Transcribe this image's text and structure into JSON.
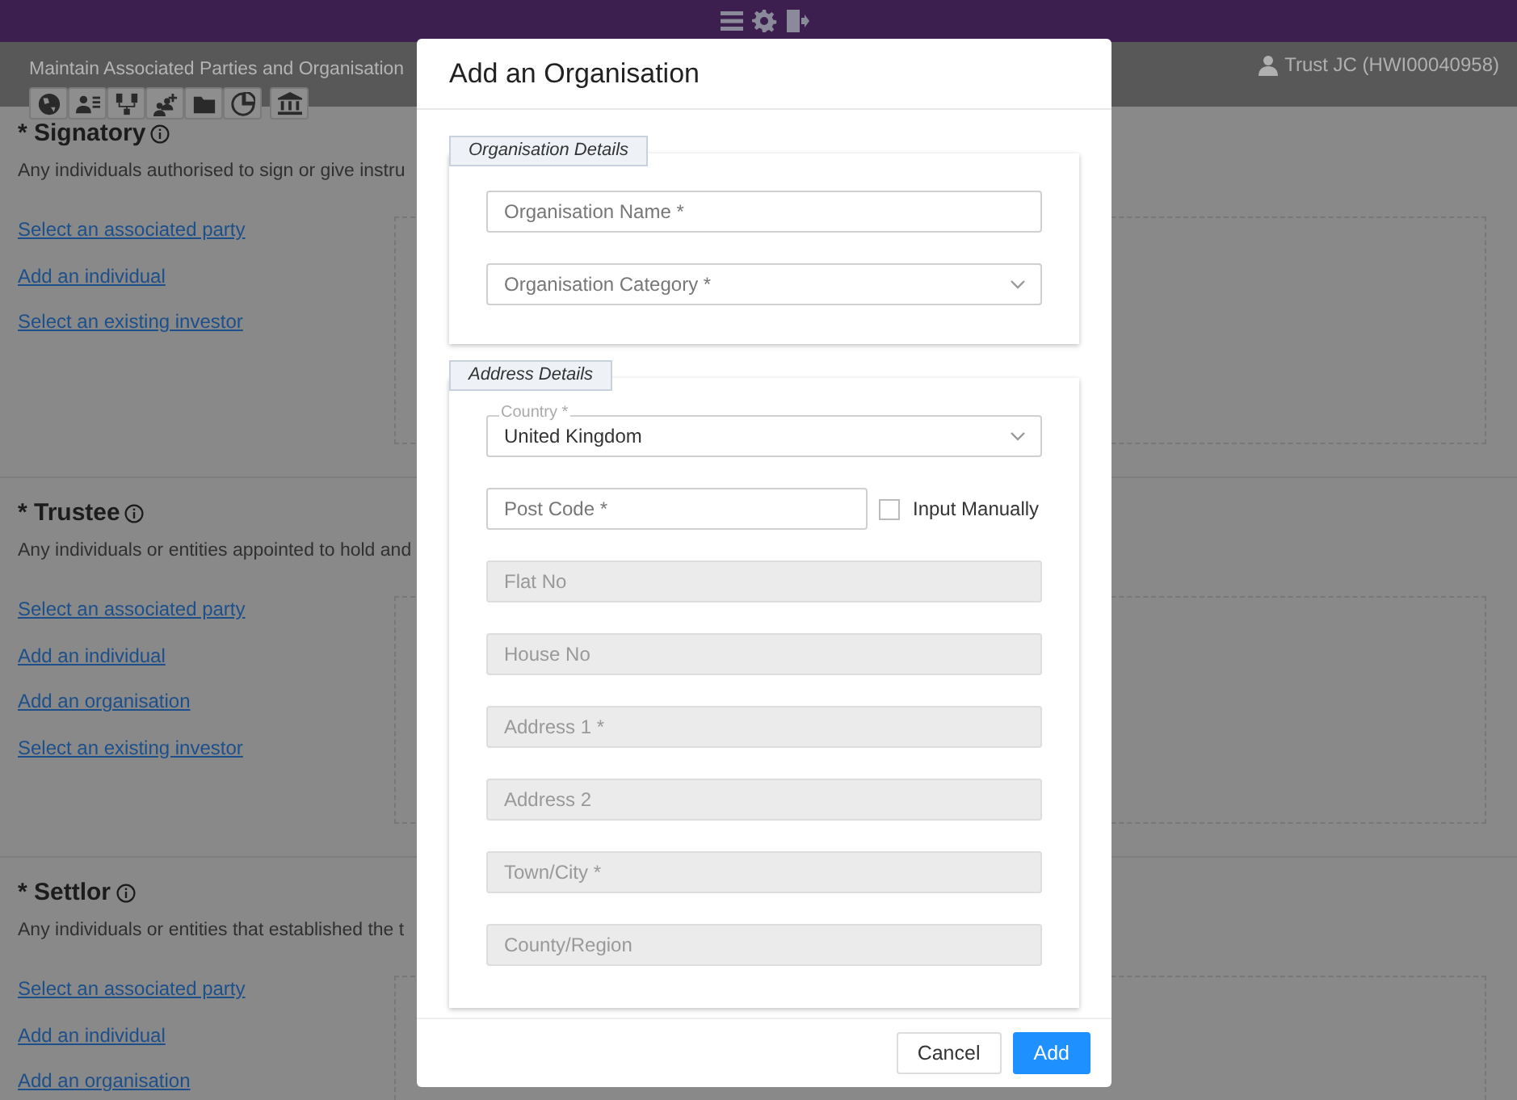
{
  "header": {
    "page_title": "Maintain Associated Parties and Organisation",
    "user": "Trust JC (HWI00040958)"
  },
  "sections": [
    {
      "title": "* Signatory",
      "description": "Any individuals authorised to sign or give instru",
      "links": [
        "Select an associated party",
        "Add an individual",
        "Select an existing investor"
      ]
    },
    {
      "title": "* Trustee",
      "description": "Any individuals or entities appointed to hold and",
      "links": [
        "Select an associated party",
        "Add an individual",
        "Add an organisation",
        "Select an existing investor"
      ]
    },
    {
      "title": "* Settlor",
      "description": "Any individuals or entities that established the t",
      "links": [
        "Select an associated party",
        "Add an individual",
        "Add an organisation"
      ]
    }
  ],
  "modal": {
    "title": "Add an Organisation",
    "groups": [
      {
        "legend": "Organisation Details",
        "fields": [
          {
            "kind": "text",
            "placeholder": "Organisation Name *",
            "disabled": false
          },
          {
            "kind": "select",
            "placeholder": "Organisation Category *",
            "disabled": false
          }
        ]
      },
      {
        "legend": "Address Details",
        "fields": [
          {
            "kind": "select",
            "label": "Country *",
            "value": "United Kingdom",
            "disabled": false
          },
          {
            "kind": "text",
            "placeholder": "Post Code *",
            "disabled": false,
            "checkbox": {
              "label": "Input Manually",
              "checked": false
            }
          },
          {
            "kind": "text",
            "placeholder": "Flat No",
            "disabled": true
          },
          {
            "kind": "text",
            "placeholder": "House No",
            "disabled": true
          },
          {
            "kind": "text",
            "placeholder": "Address 1 *",
            "disabled": true
          },
          {
            "kind": "text",
            "placeholder": "Address 2",
            "disabled": true
          },
          {
            "kind": "text",
            "placeholder": "Town/City *",
            "disabled": true
          },
          {
            "kind": "text",
            "placeholder": "County/Region",
            "disabled": true
          }
        ]
      }
    ],
    "buttons": [
      {
        "label": "Cancel",
        "kind": "secondary"
      },
      {
        "label": "Add",
        "kind": "primary"
      }
    ]
  }
}
